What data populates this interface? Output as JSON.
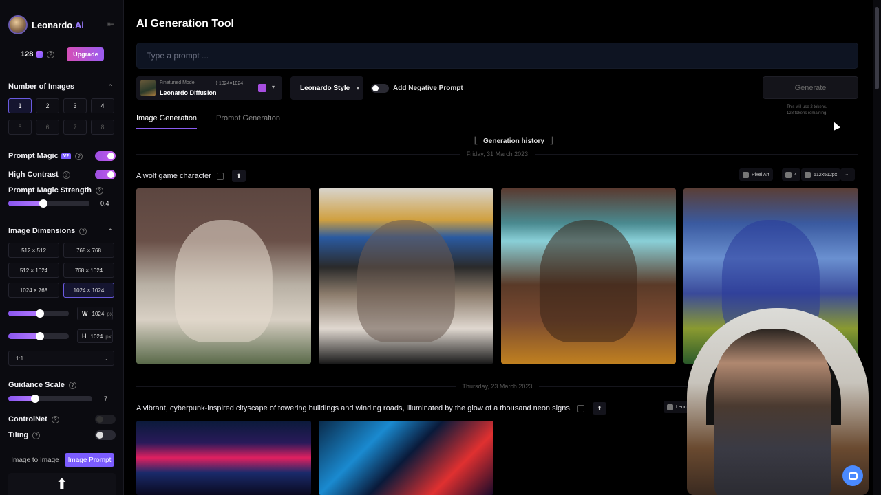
{
  "app": {
    "name": "Leonardo",
    "name_suffix": ".Ai",
    "tokens": "128",
    "upgrade_label": "Upgrade"
  },
  "sidebar": {
    "num_images_title": "Number of Images",
    "num_images": [
      "1",
      "2",
      "3",
      "4",
      "5",
      "6",
      "7",
      "8"
    ],
    "num_images_selected": "1",
    "prompt_magic_label": "Prompt Magic",
    "prompt_magic_badge": "V2",
    "high_contrast_label": "High Contrast",
    "prompt_magic_strength_label": "Prompt Magic Strength",
    "prompt_magic_strength_value": "0.4",
    "image_dimensions_title": "Image Dimensions",
    "dimensions": [
      "512 × 512",
      "768 × 768",
      "512 × 1024",
      "768 × 1024",
      "1024 × 768",
      "1024 × 1024"
    ],
    "dimension_selected": "1024 × 1024",
    "width_label": "W",
    "width_value": "1024",
    "height_label": "H",
    "height_value": "1024",
    "unit": "px",
    "aspect_ratio": "1:1",
    "guidance_scale_label": "Guidance Scale",
    "guidance_scale_value": "7",
    "controlnet_label": "ControlNet",
    "tiling_label": "Tiling",
    "image_to_image_label": "Image to Image",
    "image_prompt_label": "Image Prompt",
    "toggles": {
      "prompt_magic": true,
      "high_contrast": true,
      "controlnet": false,
      "tiling": false
    }
  },
  "main": {
    "title": "AI Generation Tool",
    "prompt_placeholder": "Type a prompt ...",
    "model": {
      "tag": "Finetuned Model",
      "resolution": "1024×1024",
      "name": "Leonardo Diffusion"
    },
    "style": "Leonardo Style",
    "negative_prompt_label": "Add Negative Prompt",
    "generate_label": "Generate",
    "generate_note_1": "This will use 2 tokens.",
    "generate_note_2": "128 tokens remaining.",
    "tabs": [
      "Image Generation",
      "Prompt Generation"
    ],
    "history_title": "Generation history",
    "date_1": "Friday, 31 March 2023",
    "generation_1": {
      "prompt": "A wolf game character",
      "meta_style": "Pixel Art",
      "meta_count": "4",
      "meta_size": "512x512px"
    },
    "date_2": "Thursday, 23 March 2023",
    "generation_2": {
      "prompt": "A vibrant, cyberpunk-inspired cityscape of towering buildings and winding roads, illuminated by the glow of a thousand neon signs.",
      "meta_model": "Leon"
    }
  }
}
